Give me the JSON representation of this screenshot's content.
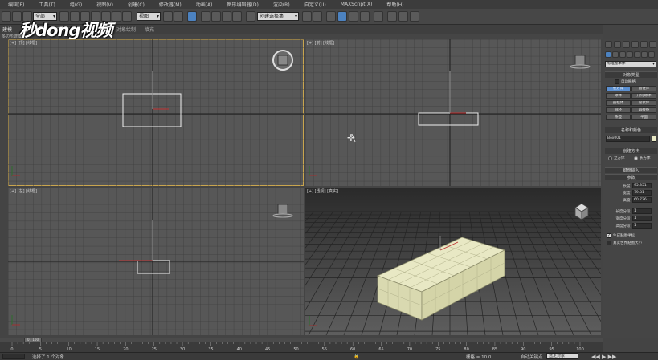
{
  "menu": [
    "编辑(E)",
    "工具(T)",
    "组(G)",
    "视图(V)",
    "创建(C)",
    "修改器(M)",
    "动画(A)",
    "图形编辑器(D)",
    "渲染(R)",
    "自定义(U)",
    "MAXScript(X)",
    "帮助(H)"
  ],
  "toolbar": {
    "selection_filter": "全部",
    "view_ref": "视图",
    "named_selection": "创建选择集",
    "ribbon_tabs": [
      "建模",
      "自由形式",
      "选择",
      "对象绘制",
      "填充"
    ],
    "ribbon_sub": "多边形建模"
  },
  "watermark": "秒dong视频",
  "viewports": {
    "top_left": "[+] [顶] [线框]",
    "top_right": "[+] [前] [线框]",
    "bottom_left": "[+] [左] [线框]",
    "bottom_right": "[+] [透视] [真实]"
  },
  "panel": {
    "dropdown": "标准基本体",
    "object_type_header": "对象类型",
    "autogrid": "自动栅格",
    "buttons": [
      "长方体",
      "圆锥体",
      "球体",
      "几何球体",
      "圆柱体",
      "管状体",
      "圆环",
      "四棱锥",
      "茶壶",
      "平面"
    ],
    "name_color_header": "名称和颜色",
    "object_name": "Box001",
    "creation_method_header": "创建方法",
    "method_cube": "立方体",
    "method_box": "长方体",
    "keyboard_entry_header": "键盘输入",
    "params_header": "参数",
    "length_label": "长度:",
    "length_value": "95.351",
    "width_label": "宽度:",
    "width_value": "79.81",
    "height_label": "高度:",
    "height_value": "60.726",
    "lseg_label": "长度分段:",
    "lseg_value": "1",
    "wseg_label": "宽度分段:",
    "wseg_value": "1",
    "hseg_label": "高度分段:",
    "hseg_value": "1",
    "gen_uv": "生成贴图坐标",
    "real_world": "真实世界贴图大小"
  },
  "timeline": {
    "frame": "0 / 100",
    "ticks": [
      "0",
      "5",
      "10",
      "15",
      "20",
      "25",
      "30",
      "35",
      "40",
      "45",
      "50",
      "55",
      "60",
      "65",
      "70",
      "75",
      "80",
      "85",
      "90",
      "95",
      "100"
    ]
  },
  "status": {
    "message": "选择了 1 个对象",
    "grid": "栅格 = 10.0",
    "autokey": "自动关键点",
    "selected": "选定对象",
    "set_key": "设置关键点"
  },
  "colors": {
    "box_fill": "#e8e8c4",
    "active_border": "#c9a54e",
    "panel_highlight": "#5b8fd0"
  }
}
